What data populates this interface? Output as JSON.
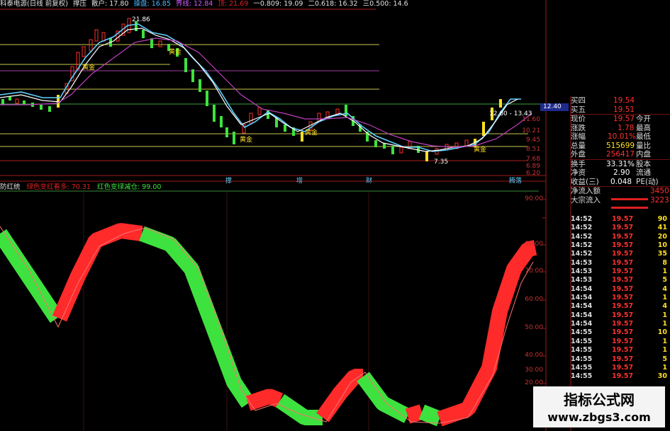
{
  "header": {
    "title": "科泰电源(日线 前复权)",
    "indicator": "撑压",
    "items": [
      {
        "label": "散户: 17.80",
        "color": "#e0e0e0"
      },
      {
        "label": "操盘: 16.85",
        "color": "#4ab8ff"
      },
      {
        "label": "界线: 12.84",
        "color": "#d45cff"
      },
      {
        "label": "顶: 21.69",
        "color": "#e02020"
      },
      {
        "label": "一0.809: 19.09",
        "color": "#e0e0e0"
      },
      {
        "label": "二0.618: 16.32",
        "color": "#e0e0e0"
      },
      {
        "label": "三0.500: 14.6",
        "color": "#e0e0e0"
      }
    ]
  },
  "upper_chart": {
    "price_labels": {
      "high": "21.86",
      "low": "7.35",
      "range": "12.80 - 13.43",
      "current": "12.40"
    },
    "markers": [
      "黄金",
      "黄金",
      "黄金",
      "黄金",
      "黄金"
    ],
    "axis_ticks": [
      "11.60",
      "10.21",
      "9.45",
      "8.51",
      "7.68",
      "6.89",
      "6.20"
    ],
    "bottom_labels": [
      "撑",
      "增",
      "财",
      "腾落"
    ]
  },
  "indicator_panel": {
    "name": "防红统",
    "legend_green": "绿色变红看多: 70.31",
    "legend_red": "红色变绿减仓: 99.00",
    "axis_ticks": [
      "90.00",
      "80.00",
      "70.00",
      "60.00",
      "50.00",
      "40.00",
      "30.00",
      "20.00"
    ]
  },
  "quote": [
    {
      "label": "买四",
      "value": "19.54",
      "extra": "",
      "bar": false
    },
    {
      "label": "买五",
      "value": "19.51",
      "extra": "",
      "bar": false
    },
    {
      "label": "现价",
      "value": "19.57",
      "extra": "今开",
      "bar": false
    },
    {
      "label": "涨跌",
      "value": "1.78",
      "extra": "最高",
      "bar": false
    },
    {
      "label": "涨幅",
      "value": "10.01%",
      "extra": "最低",
      "bar": false
    },
    {
      "label": "总量",
      "value": "515699",
      "extra": "量比",
      "bar": false
    },
    {
      "label": "外盘",
      "value": "256417",
      "extra": "内盘",
      "bar": false
    },
    {
      "label": "换手",
      "value": "33.31%",
      "extra": "股本",
      "bar": false
    },
    {
      "label": "净资",
      "value": "2.90",
      "extra": "流通",
      "bar": false
    },
    {
      "label": "收益(三)",
      "value": "0.048",
      "extra": "PE(动)",
      "bar": false
    },
    {
      "label": "净流入额",
      "value": "",
      "extra": "3450",
      "bar": true
    },
    {
      "label": "大宗流入",
      "value": "",
      "extra": "3223",
      "bar": true
    }
  ],
  "ticks": [
    {
      "time": "14:52",
      "price": "19.57",
      "vol": "90"
    },
    {
      "time": "14:52",
      "price": "19.57",
      "vol": "41"
    },
    {
      "time": "14:52",
      "price": "19.57",
      "vol": "20"
    },
    {
      "time": "14:52",
      "price": "19.57",
      "vol": "10"
    },
    {
      "time": "14:52",
      "price": "19.57",
      "vol": "35"
    },
    {
      "time": "14:53",
      "price": "19.57",
      "vol": "8"
    },
    {
      "time": "14:53",
      "price": "19.57",
      "vol": "1"
    },
    {
      "time": "14:53",
      "price": "19.57",
      "vol": "5"
    },
    {
      "time": "14:54",
      "price": "19.57",
      "vol": "4"
    },
    {
      "time": "14:54",
      "price": "19.57",
      "vol": "1"
    },
    {
      "time": "14:54",
      "price": "19.57",
      "vol": "4"
    },
    {
      "time": "14:54",
      "price": "19.57",
      "vol": "1"
    },
    {
      "time": "14:54",
      "price": "19.57",
      "vol": "1"
    },
    {
      "time": "14:55",
      "price": "19.57",
      "vol": "10"
    },
    {
      "time": "14:55",
      "price": "19.57",
      "vol": "1"
    },
    {
      "time": "14:55",
      "price": "19.57",
      "vol": "1"
    },
    {
      "time": "14:55",
      "price": "19.57",
      "vol": "5"
    },
    {
      "time": "14:55",
      "price": "19.57",
      "vol": "1"
    },
    {
      "time": "14:55",
      "price": "19.57",
      "vol": "30"
    }
  ],
  "watermark": {
    "line1": "指标公式网",
    "line2": "www.zbgs3.com"
  },
  "colors": {
    "up": "#ff2a2a",
    "down": "#3ee23e",
    "bg": "#000000",
    "axis": "#b01e1e",
    "ma1": "#ffffff",
    "ma2": "#5fd0ff",
    "ma3": "#c040c0"
  }
}
